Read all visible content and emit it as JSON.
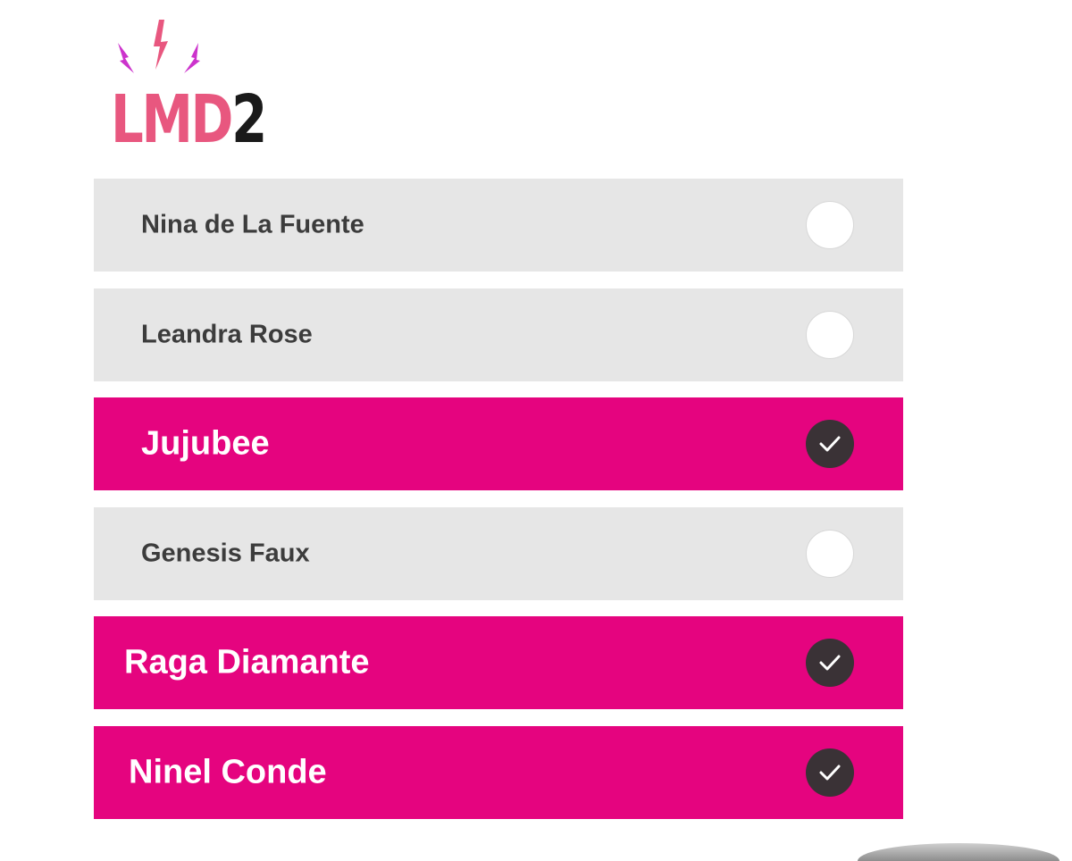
{
  "logo": {
    "text_main": "LMD",
    "text_accent": "2"
  },
  "colors": {
    "selected_bg": "#e5047f",
    "unselected_bg": "#e6e6e6",
    "check_circle": "#3a3236",
    "logo_pink": "#e8577f"
  },
  "options": [
    {
      "label": "Nina de La Fuente",
      "selected": false
    },
    {
      "label": "Leandra Rose",
      "selected": false
    },
    {
      "label": "Jujubee",
      "selected": true
    },
    {
      "label": "Genesis Faux",
      "selected": false
    },
    {
      "label": "Raga Diamante",
      "selected": true
    },
    {
      "label": "Ninel Conde",
      "selected": true
    }
  ]
}
